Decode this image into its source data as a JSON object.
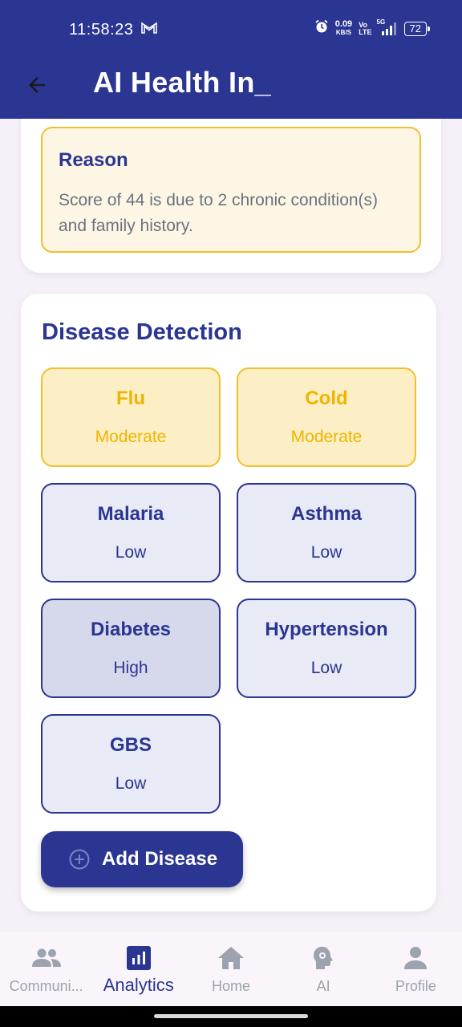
{
  "status_bar": {
    "time": "11:58:23",
    "net_speed_value": "0.09",
    "net_speed_unit": "KB/S",
    "volte_top": "Vo",
    "volte_bottom": "LTE",
    "network": "5G",
    "battery": "72"
  },
  "app_bar": {
    "title": "AI Health In_"
  },
  "reason": {
    "title": "Reason",
    "text": "Score of 44 is due to 2 chronic condition(s) and family history."
  },
  "disease_detection": {
    "title": "Disease Detection",
    "diseases": [
      {
        "name": "Flu",
        "level": "Moderate"
      },
      {
        "name": "Cold",
        "level": "Moderate"
      },
      {
        "name": "Malaria",
        "level": "Low"
      },
      {
        "name": "Asthma",
        "level": "Low"
      },
      {
        "name": "Diabetes",
        "level": "High"
      },
      {
        "name": "Hypertension",
        "level": "Low"
      },
      {
        "name": "GBS",
        "level": "Low"
      }
    ],
    "add_button_label": "Add Disease"
  },
  "bottom_nav": {
    "items": [
      {
        "label": "Communi...",
        "icon": "people-icon"
      },
      {
        "label": "Analytics",
        "icon": "analytics-icon"
      },
      {
        "label": "Home",
        "icon": "home-icon"
      },
      {
        "label": "AI",
        "icon": "ai-brain-icon"
      },
      {
        "label": "Profile",
        "icon": "person-icon"
      }
    ],
    "active": "Analytics"
  },
  "colors": {
    "primary": "#2b3592",
    "moderate": "#f0b400",
    "moderate_bg": "#fdefc5",
    "low_bg": "#e8eaf5",
    "high_bg": "#d6d9eb"
  }
}
